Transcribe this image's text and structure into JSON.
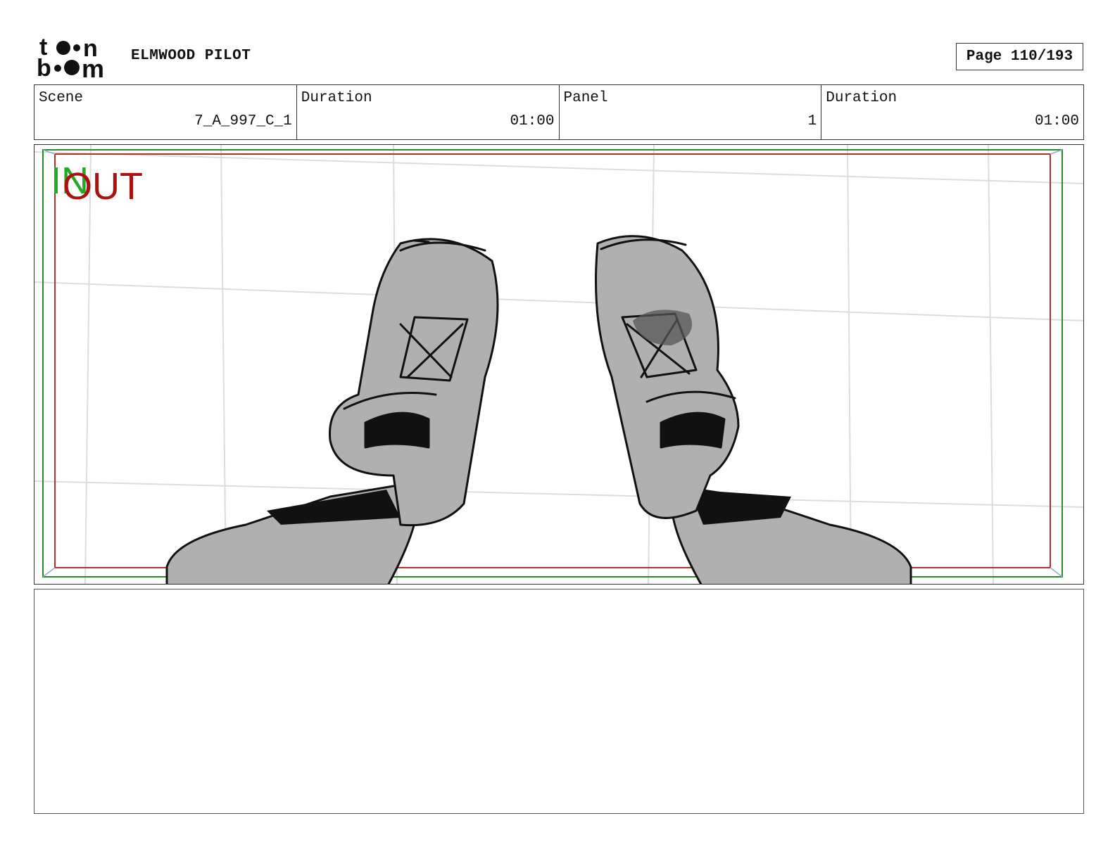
{
  "header": {
    "logo": "toon-boom-logo",
    "project_title": "ELMWOOD PILOT",
    "page_label": "Page 110/193"
  },
  "info": {
    "scene_label": "Scene",
    "scene_value": "7_A_997_C_1",
    "scene_duration_label": "Duration",
    "scene_duration_value": "01:00",
    "panel_label": "Panel",
    "panel_value": "1",
    "panel_duration_label": "Duration",
    "panel_duration_value": "01:00"
  },
  "panel": {
    "in_marker": "IN",
    "out_marker": "OUT",
    "safe_frame_colors": {
      "in": "#22aa22",
      "out": "#aa1111"
    }
  },
  "notes": {
    "text": ""
  }
}
